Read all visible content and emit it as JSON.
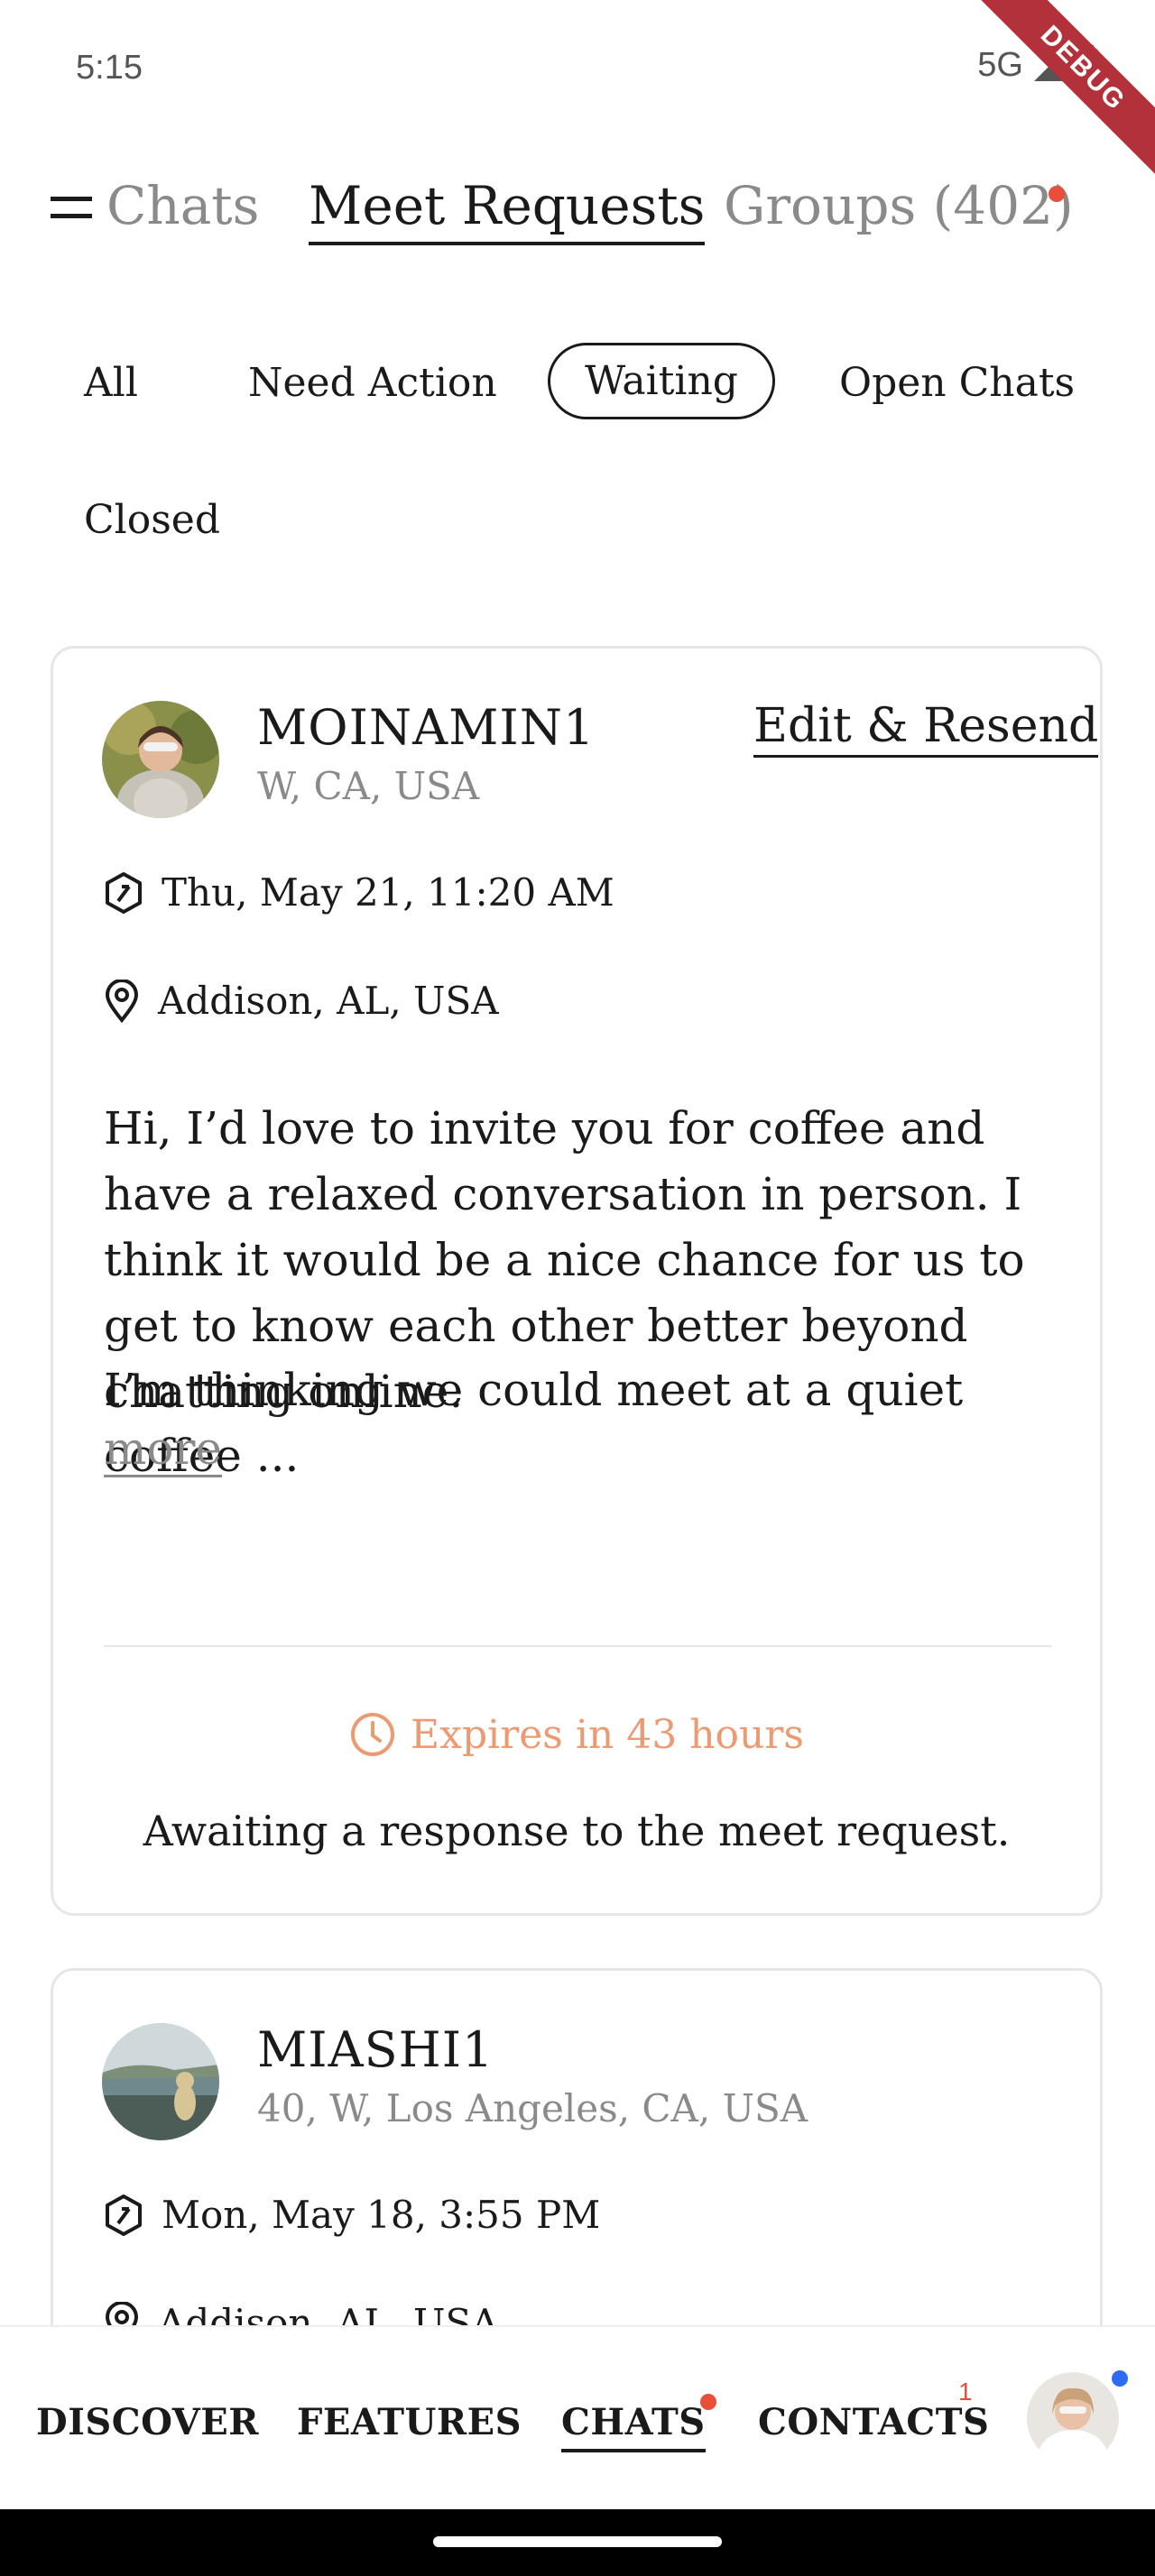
{
  "status": {
    "time": "5:15",
    "network": "5G",
    "debug": "DEBUG"
  },
  "top_tabs": [
    {
      "label": "Chats"
    },
    {
      "label": "Meet Requests"
    },
    {
      "label": "Groups (402)"
    }
  ],
  "filters": [
    "All",
    "Need Action",
    "Waiting",
    "Open Chats",
    "Closed"
  ],
  "cards": [
    {
      "username": "MOINAMIN1",
      "subinfo": "W, CA, USA",
      "action": "Edit & Resend",
      "datetime": "Thu, May 21, 11:20 AM",
      "location": "Addison, AL, USA",
      "message_p1": "Hi, I’d love to invite you for coffee and have a relaxed conversation in person. I think it would be a nice chance for us to get to know each other better beyond chatting online.",
      "message_p2": "I’m thinking we could meet at a quiet coffee ...",
      "more": "more",
      "expires": "Expires in 43 hours",
      "status_text": "Awaiting a response to the meet request."
    },
    {
      "username": "MIASHI1",
      "subinfo": "40, W, Los Angeles, CA, USA",
      "datetime": "Mon, May 18, 3:55 PM",
      "location": "Addison, AL, USA"
    }
  ],
  "bottom_nav": {
    "items": [
      {
        "label": "DISCOVER"
      },
      {
        "label": "FEATURES"
      },
      {
        "label": "CHATS"
      },
      {
        "label": "CONTACTS"
      }
    ],
    "contacts_badge": "1"
  },
  "colors": {
    "accent_red": "#e84e3a",
    "expires_orange": "#eb9a72",
    "notification_blue": "#2f6cf5"
  }
}
